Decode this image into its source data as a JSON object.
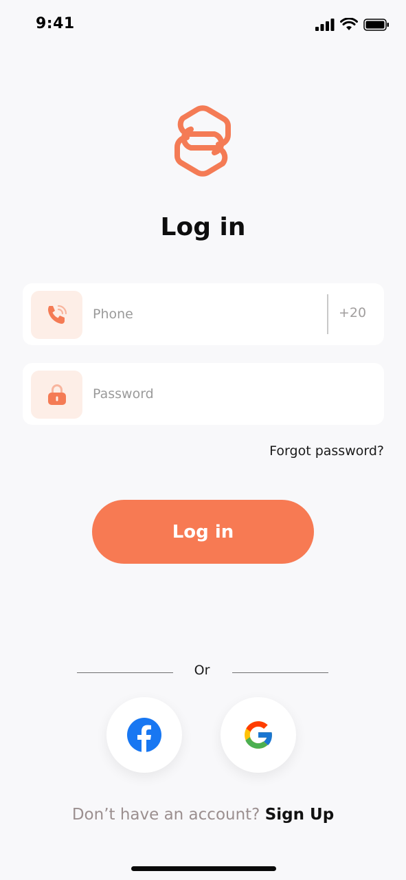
{
  "status_bar": {
    "time": "9:41"
  },
  "title": "Log in",
  "phone_field": {
    "placeholder": "Phone",
    "value": "",
    "country_code": "+20",
    "icon": "phone-icon"
  },
  "password_field": {
    "placeholder": "Password",
    "value": "",
    "icon": "lock-icon"
  },
  "forgot_password": "Forgot password?",
  "login_button": "Log in",
  "divider_text": "Or",
  "social": {
    "facebook_icon": "facebook-icon",
    "google_icon": "google-icon"
  },
  "signup": {
    "prompt": "Don’t have an account?",
    "link": "Sign Up"
  },
  "colors": {
    "accent": "#f77a53",
    "icon_bg": "#fdeee7",
    "background": "#f8f8fa",
    "facebook": "#1877f2"
  }
}
